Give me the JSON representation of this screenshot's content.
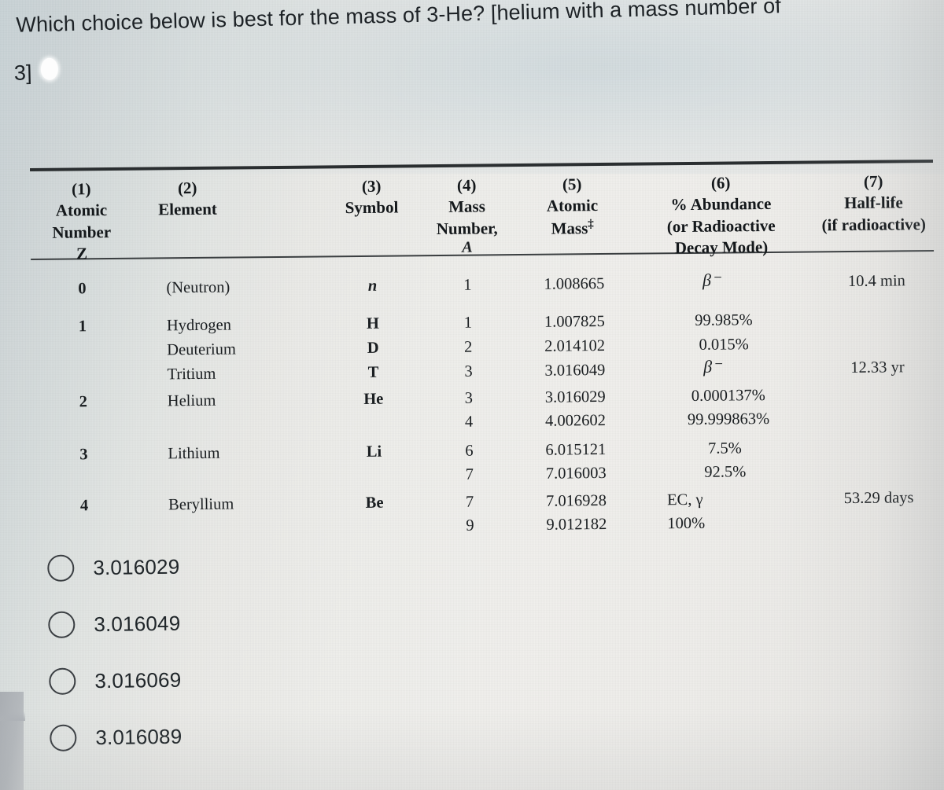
{
  "question": {
    "line1": "Which choice below is best for the mass of 3-He? [helium with a mass number of",
    "line2": "3]"
  },
  "table": {
    "headers": [
      {
        "num": "(1)",
        "lines": [
          "Atomic",
          "Number",
          "Z"
        ]
      },
      {
        "num": "(2)",
        "lines": [
          "Element"
        ]
      },
      {
        "num": "(3)",
        "lines": [
          "Symbol"
        ]
      },
      {
        "num": "(4)",
        "lines": [
          "Mass",
          "Number,",
          "A"
        ]
      },
      {
        "num": "(5)",
        "lines": [
          "Atomic",
          "Mass"
        ],
        "dagger": "‡"
      },
      {
        "num": "(6)",
        "lines": [
          "% Abundance",
          "(or Radioactive",
          "Decay Mode)"
        ]
      },
      {
        "num": "(7)",
        "lines": [
          "Half-life",
          "(if radioactive)"
        ]
      }
    ],
    "rows": [
      {
        "atomic_number": "0",
        "element": "(Neutron)",
        "symbol": "n",
        "symbol_italic": true,
        "isotopes": [
          {
            "mass_number": "1",
            "atomic_mass": "1.008665",
            "abundance": "β⁻",
            "abundance_is_decay": true,
            "half_life": "10.4 min"
          }
        ]
      },
      {
        "atomic_number": "1",
        "element": "Hydrogen",
        "symbol": "H",
        "extra_elements": [
          "Deuterium",
          "Tritium"
        ],
        "extra_symbols": [
          "D",
          "T"
        ],
        "isotopes": [
          {
            "mass_number": "1",
            "atomic_mass": "1.007825",
            "abundance": "99.985%",
            "half_life": ""
          },
          {
            "mass_number": "2",
            "atomic_mass": "2.014102",
            "abundance": "0.015%",
            "half_life": ""
          },
          {
            "mass_number": "3",
            "atomic_mass": "3.016049",
            "abundance": "β⁻",
            "abundance_is_decay": true,
            "half_life": "12.33 yr"
          }
        ]
      },
      {
        "atomic_number": "2",
        "element": "Helium",
        "symbol": "He",
        "isotopes": [
          {
            "mass_number": "3",
            "atomic_mass": "3.016029",
            "abundance": "0.000137%",
            "half_life": ""
          },
          {
            "mass_number": "4",
            "atomic_mass": "4.002602",
            "abundance": "99.999863%",
            "half_life": ""
          }
        ]
      },
      {
        "atomic_number": "3",
        "element": "Lithium",
        "symbol": "Li",
        "isotopes": [
          {
            "mass_number": "6",
            "atomic_mass": "6.015121",
            "abundance": "7.5%",
            "half_life": ""
          },
          {
            "mass_number": "7",
            "atomic_mass": "7.016003",
            "abundance": "92.5%",
            "half_life": ""
          }
        ]
      },
      {
        "atomic_number": "4",
        "element": "Beryllium",
        "symbol": "Be",
        "isotopes": [
          {
            "mass_number": "7",
            "atomic_mass": "7.016928",
            "abundance": "EC, γ",
            "half_life": "53.29 days"
          },
          {
            "mass_number": "9",
            "atomic_mass": "9.012182",
            "abundance": "100%",
            "half_life": ""
          }
        ]
      }
    ]
  },
  "choices": [
    {
      "label": "3.016029",
      "selected": false
    },
    {
      "label": "3.016049",
      "selected": false
    },
    {
      "label": "3.016069",
      "selected": false
    },
    {
      "label": "3.016089",
      "selected": false
    }
  ],
  "colors": {
    "background": "#eeeeeb",
    "background_top": "#c9d3d7",
    "text": "#1d2226",
    "rule": "#2a2e30",
    "radio_border": "#3a3e42"
  }
}
